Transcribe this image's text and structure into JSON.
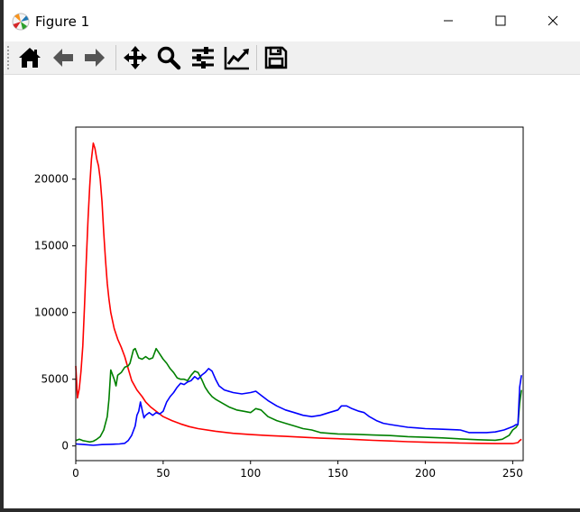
{
  "window": {
    "title": "Figure 1",
    "icons": [
      "matplotlib-logo",
      "minimize-icon",
      "maximize-icon",
      "close-icon"
    ]
  },
  "toolbar": {
    "items": [
      {
        "name": "home",
        "icon": "home-icon"
      },
      {
        "name": "back",
        "icon": "arrow-left-icon"
      },
      {
        "name": "forward",
        "icon": "arrow-right-icon"
      },
      {
        "name": "pan",
        "icon": "move-icon"
      },
      {
        "name": "zoom",
        "icon": "zoom-icon"
      },
      {
        "name": "subplots",
        "icon": "sliders-icon"
      },
      {
        "name": "customize",
        "icon": "line-chart-icon"
      },
      {
        "name": "save",
        "icon": "floppy-disk-icon"
      }
    ]
  },
  "chart_data": {
    "type": "line",
    "title": "",
    "xlabel": "",
    "ylabel": "",
    "xlim": [
      0,
      256
    ],
    "ylim": [
      -1100,
      23900
    ],
    "xticks": [
      0,
      50,
      100,
      150,
      200,
      250
    ],
    "yticks": [
      0,
      5000,
      10000,
      15000,
      20000
    ],
    "grid": false,
    "legend": false,
    "series": [
      {
        "color": "#ff0000",
        "points": [
          [
            0,
            6000
          ],
          [
            1,
            3600
          ],
          [
            2,
            4300
          ],
          [
            3,
            5600
          ],
          [
            4,
            7500
          ],
          [
            5,
            10500
          ],
          [
            6,
            13800
          ],
          [
            7,
            17000
          ],
          [
            8,
            19500
          ],
          [
            9,
            21500
          ],
          [
            10,
            22700
          ],
          [
            11,
            22300
          ],
          [
            12,
            21500
          ],
          [
            13,
            21000
          ],
          [
            14,
            20000
          ],
          [
            15,
            18300
          ],
          [
            16,
            16000
          ],
          [
            17,
            14000
          ],
          [
            18,
            12200
          ],
          [
            19,
            11000
          ],
          [
            20,
            10000
          ],
          [
            22,
            8800
          ],
          [
            24,
            8000
          ],
          [
            26,
            7400
          ],
          [
            28,
            6700
          ],
          [
            30,
            5800
          ],
          [
            32,
            4900
          ],
          [
            35,
            4200
          ],
          [
            38,
            3700
          ],
          [
            40,
            3300
          ],
          [
            43,
            2900
          ],
          [
            45,
            2700
          ],
          [
            48,
            2400
          ],
          [
            50,
            2200
          ],
          [
            55,
            1900
          ],
          [
            60,
            1650
          ],
          [
            65,
            1450
          ],
          [
            70,
            1300
          ],
          [
            80,
            1100
          ],
          [
            90,
            950
          ],
          [
            100,
            850
          ],
          [
            110,
            780
          ],
          [
            120,
            720
          ],
          [
            130,
            650
          ],
          [
            140,
            580
          ],
          [
            150,
            540
          ],
          [
            160,
            480
          ],
          [
            170,
            420
          ],
          [
            180,
            370
          ],
          [
            190,
            320
          ],
          [
            200,
            280
          ],
          [
            210,
            250
          ],
          [
            220,
            220
          ],
          [
            230,
            200
          ],
          [
            240,
            180
          ],
          [
            250,
            180
          ],
          [
            253,
            250
          ],
          [
            254,
            400
          ],
          [
            255,
            500
          ]
        ]
      },
      {
        "color": "#008000",
        "points": [
          [
            0,
            400
          ],
          [
            2,
            500
          ],
          [
            4,
            400
          ],
          [
            6,
            350
          ],
          [
            8,
            300
          ],
          [
            10,
            350
          ],
          [
            12,
            500
          ],
          [
            14,
            700
          ],
          [
            16,
            1200
          ],
          [
            18,
            2200
          ],
          [
            19,
            3500
          ],
          [
            20,
            5700
          ],
          [
            22,
            5000
          ],
          [
            23,
            4500
          ],
          [
            24,
            5300
          ],
          [
            26,
            5500
          ],
          [
            28,
            5900
          ],
          [
            30,
            6000
          ],
          [
            31,
            6200
          ],
          [
            33,
            7200
          ],
          [
            34,
            7300
          ],
          [
            36,
            6600
          ],
          [
            38,
            6500
          ],
          [
            40,
            6700
          ],
          [
            42,
            6500
          ],
          [
            44,
            6600
          ],
          [
            46,
            7300
          ],
          [
            48,
            6900
          ],
          [
            50,
            6500
          ],
          [
            52,
            6200
          ],
          [
            54,
            5800
          ],
          [
            56,
            5500
          ],
          [
            58,
            5100
          ],
          [
            60,
            5000
          ],
          [
            62,
            5000
          ],
          [
            64,
            4900
          ],
          [
            66,
            5300
          ],
          [
            68,
            5600
          ],
          [
            70,
            5500
          ],
          [
            72,
            5000
          ],
          [
            74,
            4400
          ],
          [
            76,
            4000
          ],
          [
            78,
            3700
          ],
          [
            80,
            3500
          ],
          [
            84,
            3200
          ],
          [
            88,
            2900
          ],
          [
            92,
            2700
          ],
          [
            96,
            2600
          ],
          [
            100,
            2500
          ],
          [
            103,
            2800
          ],
          [
            106,
            2700
          ],
          [
            110,
            2200
          ],
          [
            115,
            1900
          ],
          [
            120,
            1700
          ],
          [
            125,
            1500
          ],
          [
            130,
            1300
          ],
          [
            135,
            1200
          ],
          [
            140,
            1000
          ],
          [
            145,
            950
          ],
          [
            150,
            900
          ],
          [
            160,
            870
          ],
          [
            170,
            820
          ],
          [
            180,
            780
          ],
          [
            190,
            700
          ],
          [
            200,
            650
          ],
          [
            210,
            600
          ],
          [
            220,
            530
          ],
          [
            230,
            470
          ],
          [
            240,
            430
          ],
          [
            244,
            500
          ],
          [
            248,
            800
          ],
          [
            250,
            1200
          ],
          [
            252,
            1400
          ],
          [
            253,
            1600
          ],
          [
            254,
            3200
          ],
          [
            255,
            4200
          ]
        ]
      },
      {
        "color": "#0000ff",
        "points": [
          [
            0,
            150
          ],
          [
            5,
            100
          ],
          [
            10,
            50
          ],
          [
            15,
            100
          ],
          [
            20,
            120
          ],
          [
            25,
            150
          ],
          [
            28,
            200
          ],
          [
            30,
            400
          ],
          [
            32,
            800
          ],
          [
            34,
            1500
          ],
          [
            35,
            2300
          ],
          [
            36,
            2600
          ],
          [
            37,
            3300
          ],
          [
            38,
            2700
          ],
          [
            39,
            2100
          ],
          [
            40,
            2300
          ],
          [
            42,
            2500
          ],
          [
            44,
            2300
          ],
          [
            46,
            2500
          ],
          [
            48,
            2400
          ],
          [
            50,
            2600
          ],
          [
            52,
            3300
          ],
          [
            54,
            3700
          ],
          [
            56,
            4000
          ],
          [
            58,
            4400
          ],
          [
            60,
            4700
          ],
          [
            62,
            4600
          ],
          [
            64,
            4800
          ],
          [
            66,
            4900
          ],
          [
            68,
            5200
          ],
          [
            70,
            5000
          ],
          [
            72,
            5300
          ],
          [
            74,
            5500
          ],
          [
            76,
            5800
          ],
          [
            78,
            5600
          ],
          [
            80,
            5000
          ],
          [
            82,
            4500
          ],
          [
            85,
            4200
          ],
          [
            90,
            4000
          ],
          [
            95,
            3900
          ],
          [
            100,
            4000
          ],
          [
            103,
            4100
          ],
          [
            106,
            3800
          ],
          [
            110,
            3400
          ],
          [
            115,
            3000
          ],
          [
            120,
            2700
          ],
          [
            125,
            2500
          ],
          [
            130,
            2300
          ],
          [
            135,
            2200
          ],
          [
            140,
            2300
          ],
          [
            145,
            2500
          ],
          [
            150,
            2700
          ],
          [
            152,
            3000
          ],
          [
            155,
            3000
          ],
          [
            158,
            2800
          ],
          [
            162,
            2600
          ],
          [
            165,
            2500
          ],
          [
            168,
            2200
          ],
          [
            172,
            1900
          ],
          [
            176,
            1700
          ],
          [
            180,
            1600
          ],
          [
            185,
            1500
          ],
          [
            190,
            1400
          ],
          [
            195,
            1350
          ],
          [
            200,
            1300
          ],
          [
            210,
            1250
          ],
          [
            220,
            1200
          ],
          [
            225,
            1000
          ],
          [
            230,
            1000
          ],
          [
            235,
            1000
          ],
          [
            240,
            1050
          ],
          [
            245,
            1200
          ],
          [
            250,
            1450
          ],
          [
            252,
            1600
          ],
          [
            253,
            1600
          ],
          [
            254,
            4400
          ],
          [
            255,
            5300
          ]
        ]
      }
    ]
  }
}
